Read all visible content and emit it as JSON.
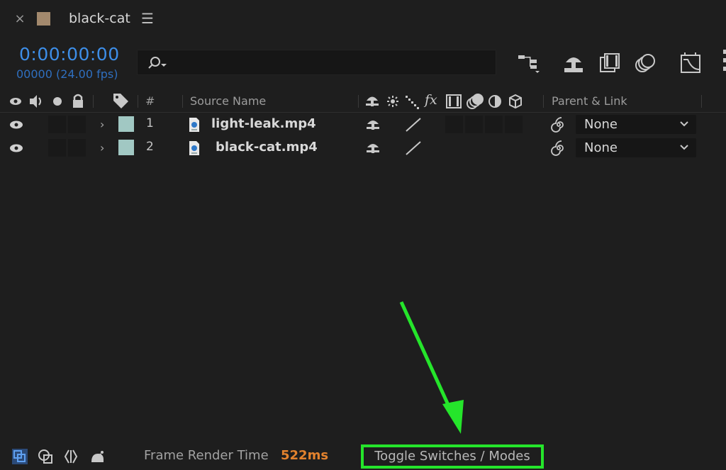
{
  "tab": {
    "close_glyph": "×",
    "title": "black-cat",
    "menu_glyph": "☰",
    "swatch_color": "#a3896d"
  },
  "timecode": {
    "time": "0:00:00:00",
    "frames": "00000 (24.00 fps)"
  },
  "search": {
    "placeholder": "",
    "value": ""
  },
  "toolbar_icons": [
    "composition-flowchart-icon",
    "draft-3d-icon",
    "frame-blending-icon",
    "motion-blur-icon",
    "graph-editor-icon"
  ],
  "header": {
    "hash": "#",
    "source_name": "Source Name",
    "parent_link": "Parent & Link",
    "fx": "fx"
  },
  "layers": [
    {
      "number": "1",
      "name": "light-leak.mp4",
      "parent": "None",
      "label_color": "#a1c8c3"
    },
    {
      "number": "2",
      "name": "black-cat.mp4",
      "parent": "None",
      "label_color": "#a1c8c3"
    }
  ],
  "bottombar": {
    "frame_render_label": "Frame Render Time",
    "frame_render_value": "522ms",
    "toggle_label": "Toggle Switches / Modes"
  },
  "annotation": {
    "arrow_color": "#25e52b",
    "highlight_color": "#25e52b"
  }
}
